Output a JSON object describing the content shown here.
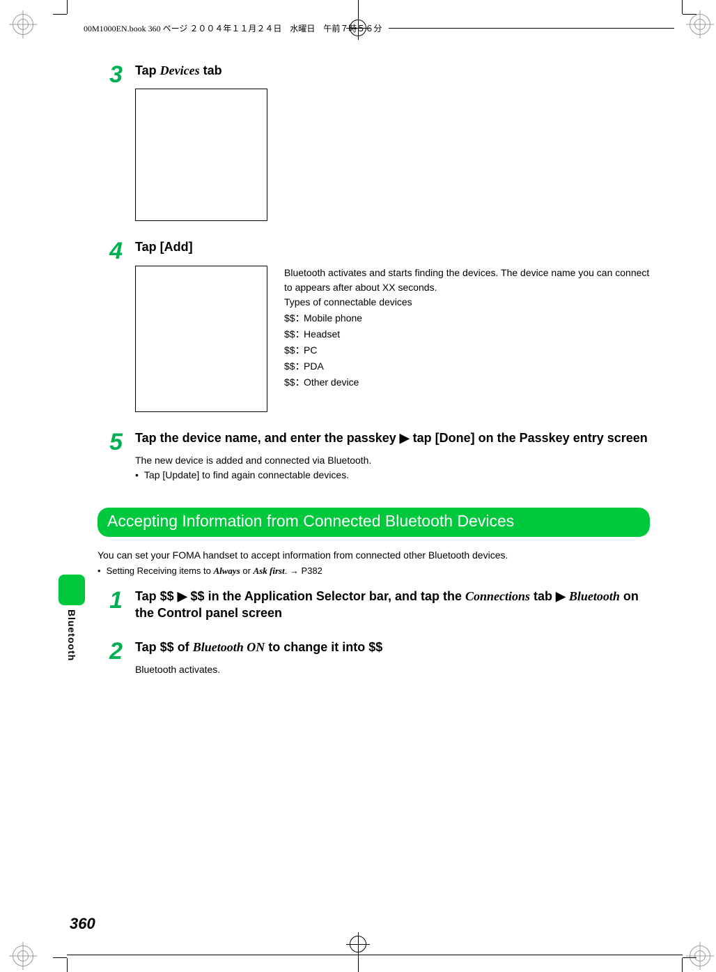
{
  "runhead": "00M1000EN.book  360 ページ  ２００４年１１月２４日　水曜日　午前７時５６分",
  "page_number": "360",
  "side_label": "Bluetooth",
  "steps_a": [
    {
      "num": "3",
      "title_pre": "Tap ",
      "title_ital": "Devices",
      "title_post": " tab"
    },
    {
      "num": "4",
      "title_pre": "Tap [Add]",
      "desc_line1": "Bluetooth activates and starts finding the devices. The device name you can connect to appears after about XX seconds.",
      "desc_line2": "Types of connectable devices",
      "devices": [
        {
          "sym": "$$：",
          "name": "Mobile phone"
        },
        {
          "sym": "$$：",
          "name": "Headset"
        },
        {
          "sym": "$$：",
          "name": "PC"
        },
        {
          "sym": "$$：",
          "name": "PDA"
        },
        {
          "sym": "$$：",
          "name": "Other device"
        }
      ]
    },
    {
      "num": "5",
      "title_full": "Tap the device name, and enter the passkey ▶ tap [Done] on the Passkey entry screen",
      "sub1": "The new device is added and connected via Bluetooth.",
      "sub2_bullet": "•",
      "sub2": "Tap [Update] to find again connectable devices."
    }
  ],
  "section_title": "Accepting Information from Connected Bluetooth Devices",
  "intro": {
    "line1": "You can set your FOMA handset to accept information from connected other Bluetooth devices.",
    "bullet_mark": "•",
    "bullet_pre": "Setting Receiving items to ",
    "bullet_ital1": "Always",
    "bullet_mid": " or ",
    "bullet_ital2": "Ask first",
    "bullet_post": ". → P382"
  },
  "steps_b": [
    {
      "num": "1",
      "parts": [
        {
          "t": "Tap $$ ",
          "ital": false
        },
        {
          "t": "▶",
          "ital": false,
          "arrow": true
        },
        {
          "t": " $$ in the Application Selector bar, and tap the ",
          "ital": false
        },
        {
          "t": "Connections",
          "ital": true
        },
        {
          "t": " tab ",
          "ital": false
        },
        {
          "t": "▶",
          "ital": false,
          "arrow": true
        },
        {
          "t": " ",
          "ital": false
        },
        {
          "t": "Bluetooth",
          "ital": true
        },
        {
          "t": " on the Control panel screen",
          "ital": false
        }
      ]
    },
    {
      "num": "2",
      "parts": [
        {
          "t": "Tap $$ of ",
          "ital": false
        },
        {
          "t": "Bluetooth ON",
          "ital": true
        },
        {
          "t": " to change it into $$",
          "ital": false
        }
      ],
      "sub": "Bluetooth activates."
    }
  ]
}
